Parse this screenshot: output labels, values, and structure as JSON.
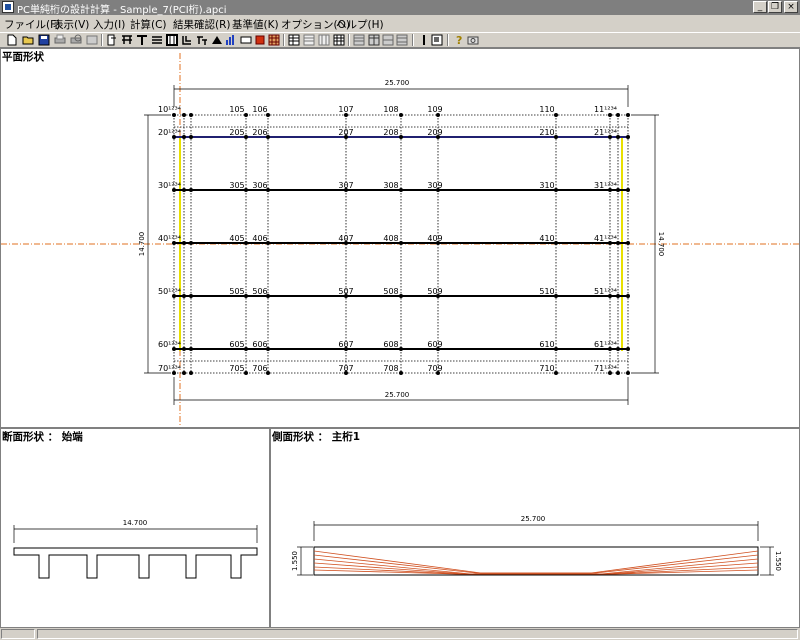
{
  "window": {
    "title": "PC単純桁の設計計算 - Sample_7(PCI桁).apci"
  },
  "menu": [
    "ファイル(F)",
    "表示(V)",
    "入力(I)",
    "計算(C)",
    "結果確認(R)",
    "基準値(K)",
    "オプション(O)",
    "ヘルプ(H)"
  ],
  "toolbar_icons": [
    "new-file-icon",
    "open-folder-icon",
    "save-icon",
    "print-icon",
    "print-preview-icon",
    "export-icon",
    "node-icon",
    "girder-icon",
    "tee-section-icon",
    "list-icon",
    "frame-icon",
    "branch-icon",
    "member-icon",
    "load-icon",
    "bar-chart-icon",
    "rect-icon",
    "red-block-icon",
    "grid-icon",
    "table-icon",
    "table2-icon",
    "table3-icon",
    "calc-icon",
    "view1-icon",
    "view2-icon",
    "view3-icon",
    "view4-icon",
    "info-icon",
    "window-icon",
    "help-icon",
    "camera-icon"
  ],
  "plan": {
    "label": "平面形状",
    "dim_top": "25.700",
    "dim_bottom": "25.700",
    "dim_left": "14.700",
    "dim_right": "14.700",
    "rows": [
      {
        "left": "10¹²³⁴",
        "nodes": [
          "105",
          "106",
          "107",
          "108",
          "109",
          "110"
        ],
        "right": "11¹²³⁴"
      },
      {
        "left": "20¹²³⁴",
        "nodes": [
          "205",
          "206",
          "207",
          "208",
          "209",
          "210"
        ],
        "right": "21¹²³⁴"
      },
      {
        "left": "30¹²³⁴",
        "nodes": [
          "305",
          "306",
          "307",
          "308",
          "309",
          "310"
        ],
        "right": "31¹²³⁴"
      },
      {
        "left": "40¹²³⁴",
        "nodes": [
          "405",
          "406",
          "407",
          "408",
          "409",
          "410"
        ],
        "right": "41¹²³⁴"
      },
      {
        "left": "50¹²³⁴",
        "nodes": [
          "505",
          "506",
          "507",
          "508",
          "509",
          "510"
        ],
        "right": "51¹²³⁴"
      },
      {
        "left": "60¹²³⁴",
        "nodes": [
          "605",
          "606",
          "607",
          "608",
          "609",
          "610"
        ],
        "right": "61¹²³⁴"
      },
      {
        "left": "70¹²³⁴",
        "nodes": [
          "705",
          "706",
          "707",
          "708",
          "709",
          "710"
        ],
        "right": "71¹²³⁴"
      }
    ]
  },
  "cross_section": {
    "label": "断面形状 ： 始端",
    "dim": "14.700"
  },
  "side_view": {
    "label": "側面形状 ： 主桁1",
    "dim_top": "25.700",
    "dim_left": "1.550",
    "dim_right": "1.550"
  }
}
